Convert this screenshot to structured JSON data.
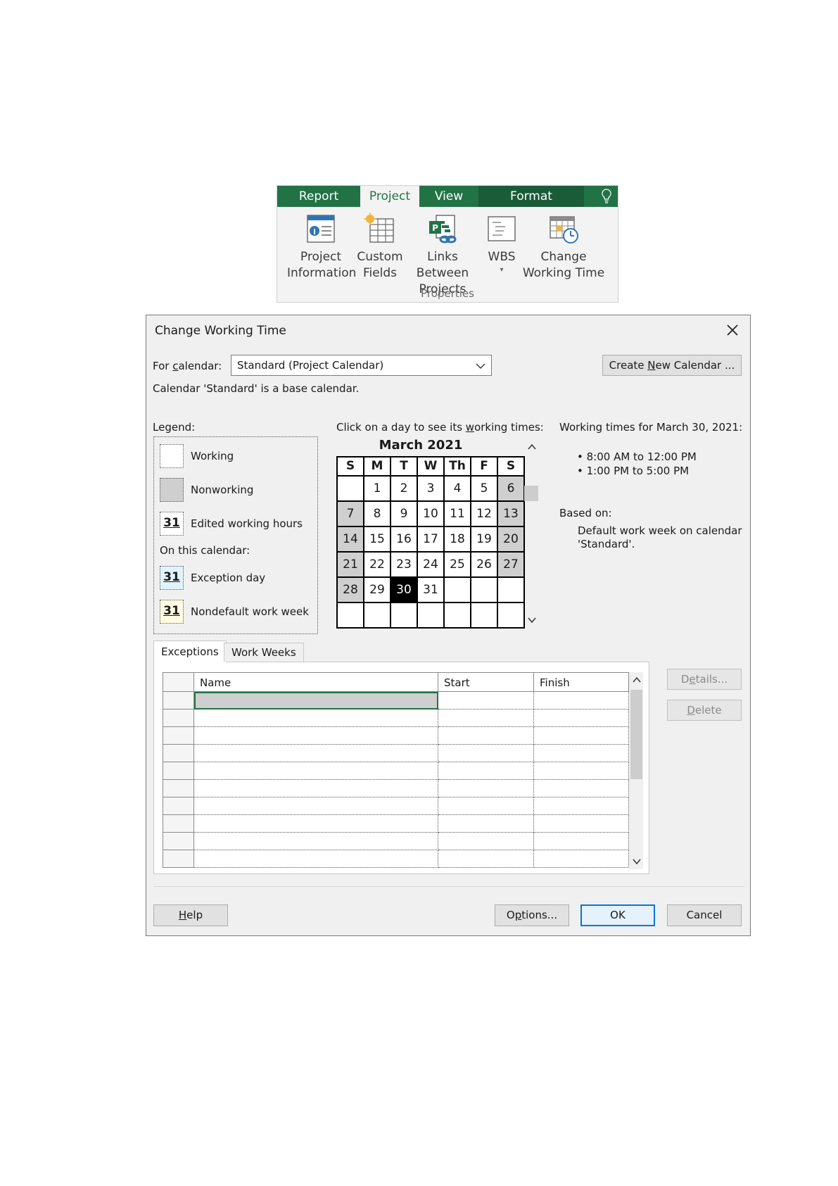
{
  "ribbon": {
    "tabs": [
      "Report",
      "Project",
      "View",
      "Format"
    ],
    "active_tab": "Project",
    "buttons": [
      {
        "line1": "Project",
        "line2": "Information",
        "icon": "project-information-icon"
      },
      {
        "line1": "Custom",
        "line2": "Fields",
        "icon": "custom-fields-icon"
      },
      {
        "line1": "Links Between",
        "line2": "Projects",
        "icon": "links-between-projects-icon"
      },
      {
        "line1": "WBS",
        "line2": "▾",
        "icon": "wbs-icon"
      },
      {
        "line1": "Change",
        "line2": "Working Time",
        "icon": "change-working-time-icon"
      }
    ],
    "group_label": "Properties",
    "colors": {
      "tab_bar": "#217346",
      "accent": "#217346"
    }
  },
  "dialog": {
    "title": "Change Working Time",
    "for_calendar_label": "For calendar:",
    "for_calendar_value": "Standard (Project Calendar)",
    "create_new_label": "Create New Calendar ...",
    "base_note": "Calendar 'Standard' is a base calendar.",
    "legend": {
      "title": "Legend:",
      "working": "Working",
      "nonworking": "Nonworking",
      "edited": "Edited working hours",
      "on_this_calendar": "On this calendar:",
      "exception": "Exception day",
      "nondefault": "Nondefault work week",
      "swatch_num": "31"
    },
    "calendar": {
      "instruction": "Click on a day to see its working times:",
      "month": "March 2021",
      "headers": [
        "S",
        "M",
        "T",
        "W",
        "Th",
        "F",
        "S"
      ],
      "weeks": [
        [
          "",
          "1",
          "2",
          "3",
          "4",
          "5",
          "6"
        ],
        [
          "7",
          "8",
          "9",
          "10",
          "11",
          "12",
          "13"
        ],
        [
          "14",
          "15",
          "16",
          "17",
          "18",
          "19",
          "20"
        ],
        [
          "21",
          "22",
          "23",
          "24",
          "25",
          "26",
          "27"
        ],
        [
          "28",
          "29",
          "30",
          "31",
          "",
          "",
          ""
        ],
        [
          "",
          "",
          "",
          "",
          "",
          "",
          ""
        ]
      ],
      "selected_day": "30"
    },
    "working_times": {
      "title": "Working times for March 30, 2021:",
      "times": [
        "• 8:00 AM to 12:00 PM",
        "• 1:00 PM to 5:00 PM"
      ],
      "based_on_label": "Based on:",
      "based_on_line1": "Default work week on calendar",
      "based_on_line2": "'Standard'."
    },
    "tabs": [
      "Exceptions",
      "Work Weeks"
    ],
    "table": {
      "columns": [
        "Name",
        "Start",
        "Finish"
      ],
      "row_count": 10
    },
    "details_label": "Details...",
    "delete_label": "Delete",
    "help_label": "Help",
    "options_label": "Options...",
    "ok_label": "OK",
    "cancel_label": "Cancel"
  }
}
